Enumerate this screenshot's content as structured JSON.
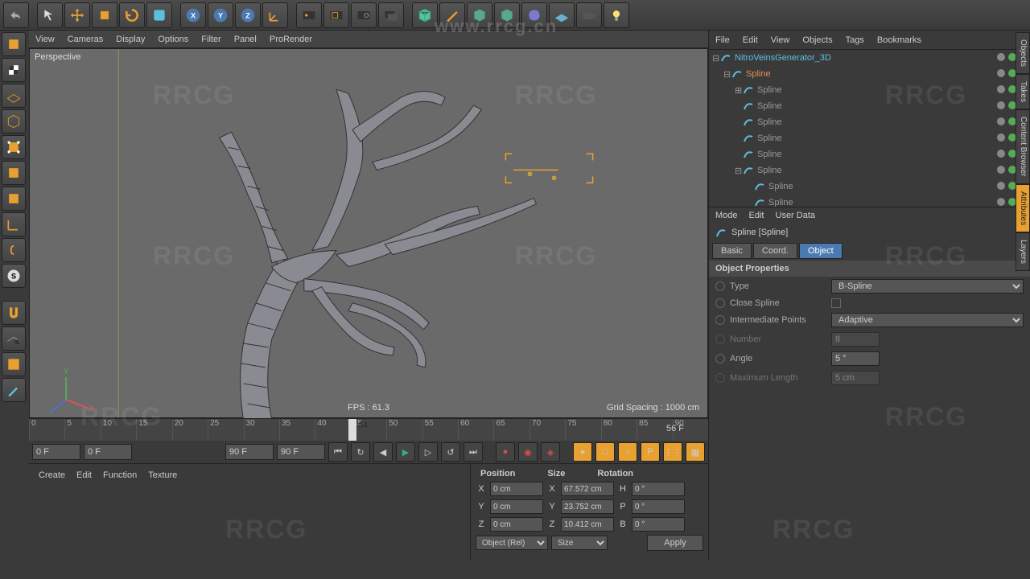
{
  "top_tools": [
    "undo",
    "live-select",
    "move",
    "scale",
    "rotate",
    "recent",
    "x-axis",
    "y-axis",
    "z-axis",
    "coord",
    "render",
    "render-region",
    "render-settings",
    "render-queue",
    "cube",
    "pen",
    "subdiv",
    "extrude",
    "deformer",
    "floor",
    "camera",
    "light"
  ],
  "obj_menu": [
    "File",
    "Edit",
    "View",
    "Objects",
    "Tags",
    "Bookmarks"
  ],
  "left_tools": [
    "model",
    "texture",
    "workplane",
    "edge-points",
    "polygon",
    "uv",
    "axis",
    "points",
    "edges",
    "polys",
    "magnet",
    "workplane2",
    "snap",
    "brush"
  ],
  "vp_menu": [
    "View",
    "Cameras",
    "Display",
    "Options",
    "Filter",
    "Panel",
    "ProRender"
  ],
  "viewport": {
    "label": "Perspective",
    "fps": "FPS : 61.3",
    "grid": "Grid Spacing : 1000 cm"
  },
  "timeline": {
    "ticks": [
      "0",
      "5",
      "10",
      "15",
      "20",
      "25",
      "30",
      "35",
      "40",
      "45",
      "50",
      "55",
      "60",
      "65",
      "70",
      "75",
      "80",
      "85",
      "90"
    ],
    "current": "44",
    "range_end": "56 F"
  },
  "playback": {
    "start": "0 F",
    "preview_start": "0 F",
    "preview_end": "90 F",
    "end": "90 F"
  },
  "mat_menu": [
    "Create",
    "Edit",
    "Function",
    "Texture"
  ],
  "coord": {
    "headers": [
      "Position",
      "Size",
      "Rotation"
    ],
    "rows": [
      {
        "axis": "X",
        "pos": "0 cm",
        "size": "67.572 cm",
        "rot_label": "H",
        "rot": "0 °"
      },
      {
        "axis": "Y",
        "pos": "0 cm",
        "size": "23.752 cm",
        "rot_label": "P",
        "rot": "0 °"
      },
      {
        "axis": "Z",
        "pos": "0 cm",
        "size": "10.412 cm",
        "rot_label": "B",
        "rot": "0 °"
      }
    ],
    "mode1": "Object (Rel)",
    "mode2": "Size",
    "apply": "Apply"
  },
  "tree": [
    {
      "name": "NitroVeinsGenerator_3D",
      "depth": 0,
      "type": "gen",
      "expand": "-"
    },
    {
      "name": "Spline",
      "depth": 1,
      "type": "active",
      "expand": "-"
    },
    {
      "name": "Spline",
      "depth": 2,
      "type": "normal",
      "expand": "+"
    },
    {
      "name": "Spline",
      "depth": 2,
      "type": "normal"
    },
    {
      "name": "Spline",
      "depth": 2,
      "type": "normal"
    },
    {
      "name": "Spline",
      "depth": 2,
      "type": "normal"
    },
    {
      "name": "Spline",
      "depth": 2,
      "type": "normal"
    },
    {
      "name": "Spline",
      "depth": 2,
      "type": "normal",
      "expand": "-"
    },
    {
      "name": "Spline",
      "depth": 3,
      "type": "normal"
    },
    {
      "name": "Spline",
      "depth": 3,
      "type": "normal"
    }
  ],
  "attr": {
    "menu": [
      "Mode",
      "Edit",
      "User Data"
    ],
    "title": "Spline [Spline]",
    "tabs": [
      "Basic",
      "Coord.",
      "Object"
    ],
    "active_tab": 2,
    "section": "Object Properties",
    "props": [
      {
        "label": "Type",
        "type": "select",
        "value": "B-Spline",
        "enabled": true
      },
      {
        "label": "Close Spline",
        "type": "check",
        "value": "",
        "enabled": true
      },
      {
        "label": "Intermediate Points",
        "type": "select",
        "value": "Adaptive",
        "enabled": true
      },
      {
        "label": "Number",
        "type": "num",
        "value": "8",
        "enabled": false
      },
      {
        "label": "Angle",
        "type": "num",
        "value": "5 °",
        "enabled": true
      },
      {
        "label": "Maximum Length",
        "type": "num",
        "value": "5 cm",
        "enabled": false
      }
    ]
  },
  "rp_tabs": [
    "Objects",
    "Takes",
    "Content Browser",
    "Attributes",
    "Layers"
  ],
  "watermark_url": "www.rrcg.cn",
  "watermark_text": "RRCG"
}
